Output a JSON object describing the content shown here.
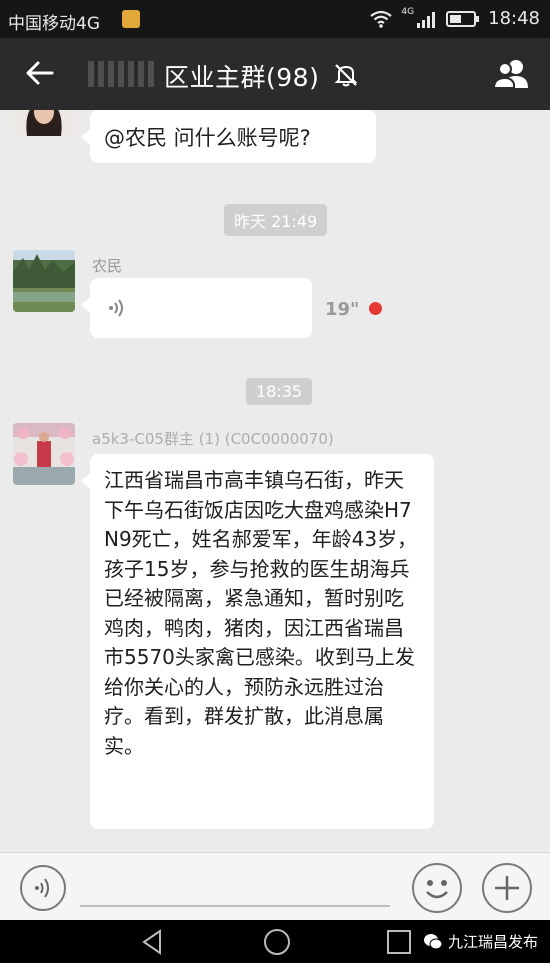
{
  "status_bar": {
    "carrier": "中国移动4G",
    "network_label": "4G",
    "time": "18:48"
  },
  "header": {
    "title": "区业主群(98)"
  },
  "messages": [
    {
      "type": "text",
      "text": "@农民  问什么账号呢?"
    },
    {
      "type": "timestamp",
      "text": "昨天 21:49"
    },
    {
      "type": "voice",
      "sender": "农民",
      "duration": "19\"",
      "unread_color": "#e53935"
    },
    {
      "type": "timestamp",
      "text": "18:35"
    },
    {
      "type": "text",
      "sender": "a5k3-C05群主 (1) (C0C0000070)",
      "text": "江西省瑞昌市高丰镇乌石街，昨天下午乌石街饭店因吃大盘鸡感染H7N9死亡，姓名郝爱军，年龄43岁，孩子15岁，参与抢救的医生胡海兵已经被隔离，紧急通知，暂时别吃鸡肉，鸭肉，猪肉，因江西省瑞昌市5570头家禽已感染。收到马上发给你关心的人，预防永远胜过治疗。看到，群发扩散，此消息属实。"
    }
  ],
  "watermark": {
    "text": "九江瑞昌发布"
  },
  "icons": {
    "back": "arrow-left-icon",
    "mute": "bell-off-icon",
    "group": "group-members-icon",
    "voice_toggle": "voice-icon",
    "emoji": "smiley-icon",
    "more": "plus-icon"
  }
}
